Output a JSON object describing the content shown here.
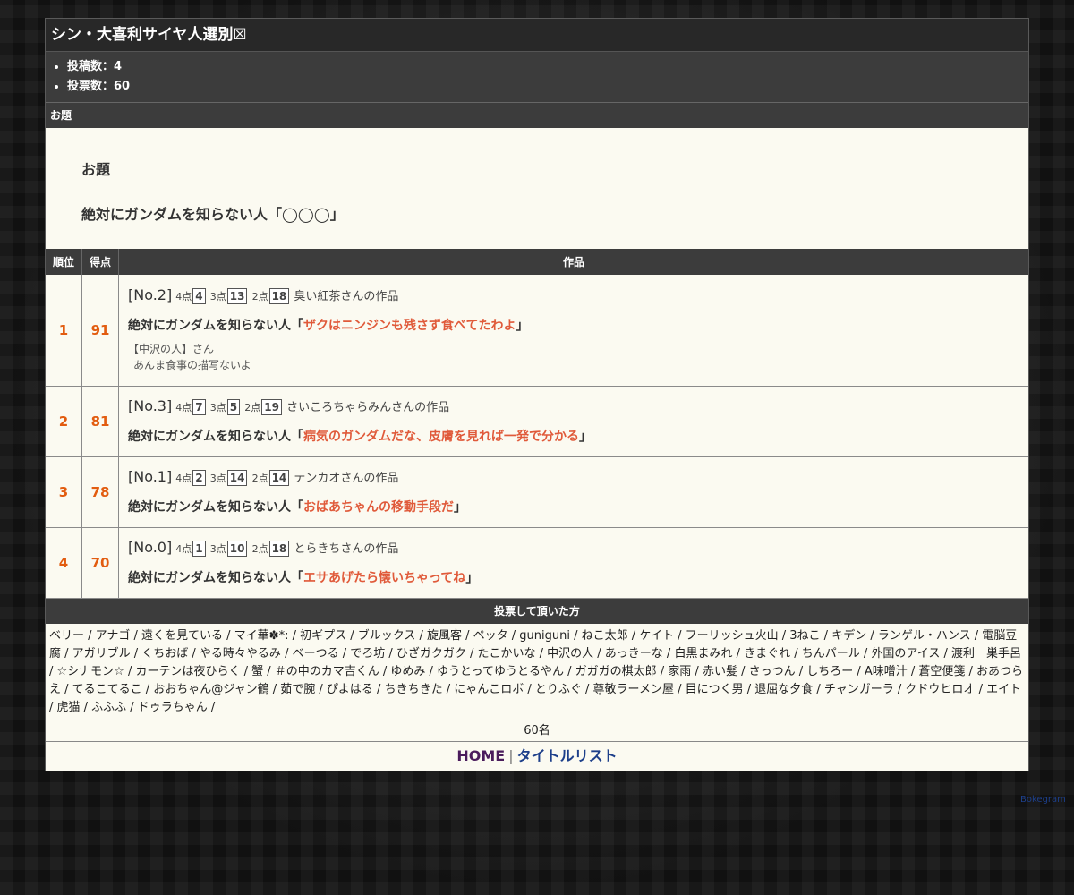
{
  "page": {
    "title": "シン・大喜利サイヤ人選別☒",
    "stats": [
      "投稿数：4",
      "投票数：60"
    ],
    "odai_header": "お題",
    "odai_label": "お題",
    "odai_text": "絶対にガンダムを知らない人「◯◯◯」"
  },
  "table": {
    "headers": [
      "順位",
      "得点",
      "作品"
    ],
    "entries": [
      {
        "rank": "1",
        "score": "91",
        "no": "[No.2]",
        "p4": "4",
        "p3": "13",
        "p2": "18",
        "author": "臭い紅茶さんの作品",
        "prefix": "絶対にガンダムを知らない人「",
        "answer": "ザクはニンジンも残さず食べてたわよ",
        "suffix": "」",
        "comment_from": "【中沢の人】さん",
        "comment": "あんま食事の描写ないよ"
      },
      {
        "rank": "2",
        "score": "81",
        "no": "[No.3]",
        "p4": "7",
        "p3": "5",
        "p2": "19",
        "author": "さいころちゃらみんさんの作品",
        "prefix": "絶対にガンダムを知らない人「",
        "answer": "病気のガンダムだな、皮膚を見れば一発で分かる",
        "suffix": "」"
      },
      {
        "rank": "3",
        "score": "78",
        "no": "[No.1]",
        "p4": "2",
        "p3": "14",
        "p2": "14",
        "author": "テンカオさんの作品",
        "prefix": "絶対にガンダムを知らない人「",
        "answer": "おばあちゃんの移動手段だ",
        "suffix": "」"
      },
      {
        "rank": "4",
        "score": "70",
        "no": "[No.0]",
        "p4": "1",
        "p3": "10",
        "p2": "18",
        "author": "とらきちさんの作品",
        "prefix": "絶対にガンダムを知らない人「",
        "answer": "エサあげたら懐いちゃってね",
        "suffix": "」"
      }
    ],
    "point_labels": {
      "p4": "4点",
      "p3": "3点",
      "p2": "2点"
    }
  },
  "voters": {
    "header": "投票して頂いた方",
    "list": "ベリー / アナゴ / 遠くを見ている / マイ華✽*: / 初ギプス / ブルックス / 旋風客 / ペッタ / guniguni / ねこ太郎 / ケイト / フーリッシュ火山 / 3ねこ / キデン / ランゲル・ハンス / 電脳豆腐 / アガリブル / くちおば / やる時々やるみ / べーつる / でろ坊 / ひざガクガク / たこかいな / 中沢の人 / あっきーな / 白黒まみれ / きまぐれ / ちんパール / 外国のアイス / 渡利　巣手呂 / ☆シナモン☆ / カーテンは夜ひらく / 蟹 / ＃の中のカマ吉くん / ゆめみ / ゆうとってゆうとるやん / ガガガの棋太郎 / 家雨 / 赤い髪 / さっつん / しちろー / A味噌汁 / 蒼空便箋 / おあつらえ / てるこてるこ / おおちゃん@ジャン鶴 / 茹で腕 / ぴよはる / ちきちきた / にゃんこロボ / とりふぐ / 尊敬ラーメン屋 / 目につく男 / 退屈な夕食 / チャンガーラ / クドウヒロオ / エイト / 虎猫 / ふふふ / ドゥラちゃん /",
    "count": "60名"
  },
  "footer": {
    "home": "HOME",
    "sep": "|",
    "list": "タイトルリスト"
  },
  "credit": "Bokegram"
}
